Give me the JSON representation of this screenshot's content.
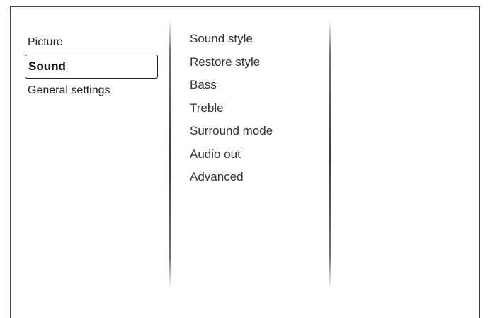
{
  "menu": {
    "categories": [
      {
        "label": "Picture",
        "selected": false
      },
      {
        "label": "Sound",
        "selected": true
      },
      {
        "label": "General settings",
        "selected": false
      }
    ],
    "submenu": [
      {
        "label": "Sound style"
      },
      {
        "label": "Restore style"
      },
      {
        "label": "Bass"
      },
      {
        "label": "Treble"
      },
      {
        "label": "Surround mode"
      },
      {
        "label": "Audio out"
      },
      {
        "label": "Advanced"
      }
    ]
  }
}
